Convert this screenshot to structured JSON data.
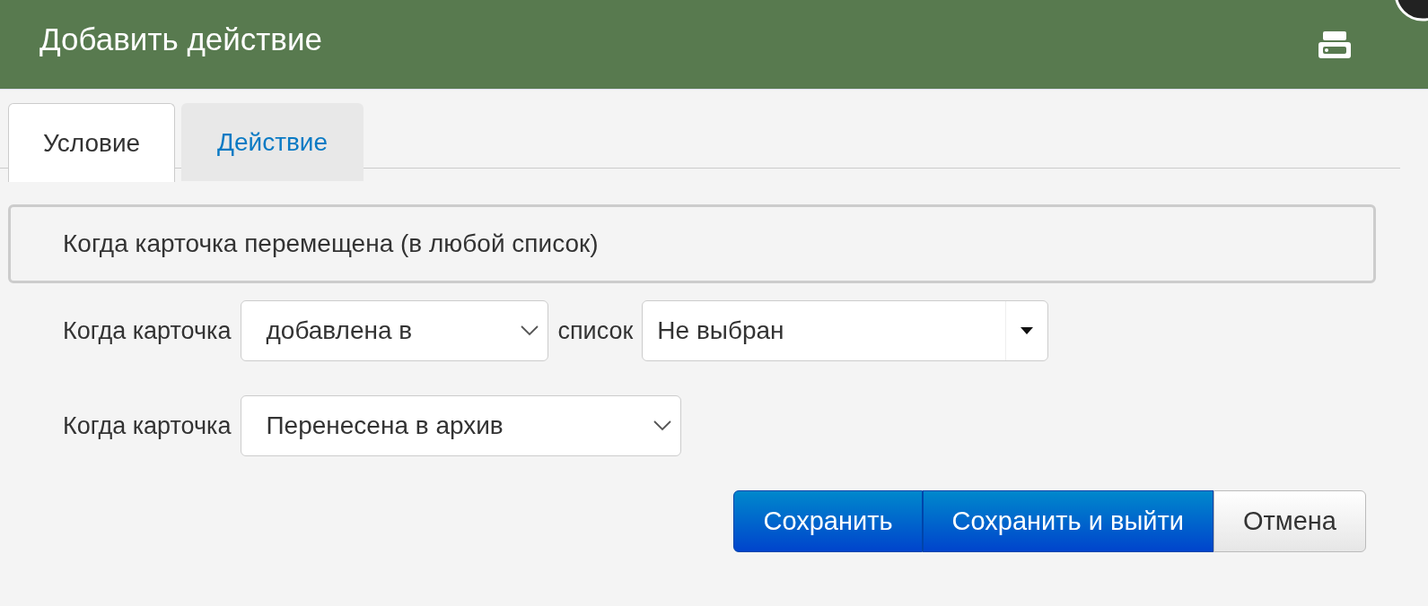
{
  "window": {
    "title": "Добавить действие"
  },
  "tabs": [
    {
      "label": "Условие",
      "selected": true
    },
    {
      "label": "Действие",
      "selected": false
    }
  ],
  "trigger": {
    "text": "Когда карточка перемещена (в любой список)"
  },
  "rows": [
    {
      "label": "Когда карточка",
      "select": "добавлена в",
      "list_label": "список",
      "list_value": "Не выбран"
    },
    {
      "label": "Когда карточка",
      "select": "Перенесена в архив"
    }
  ],
  "buttons": [
    {
      "label": "Сохранить",
      "kind": "primary"
    },
    {
      "label": "Сохранить и выйти",
      "kind": "primary"
    },
    {
      "label": "Отмена",
      "kind": "default"
    }
  ]
}
